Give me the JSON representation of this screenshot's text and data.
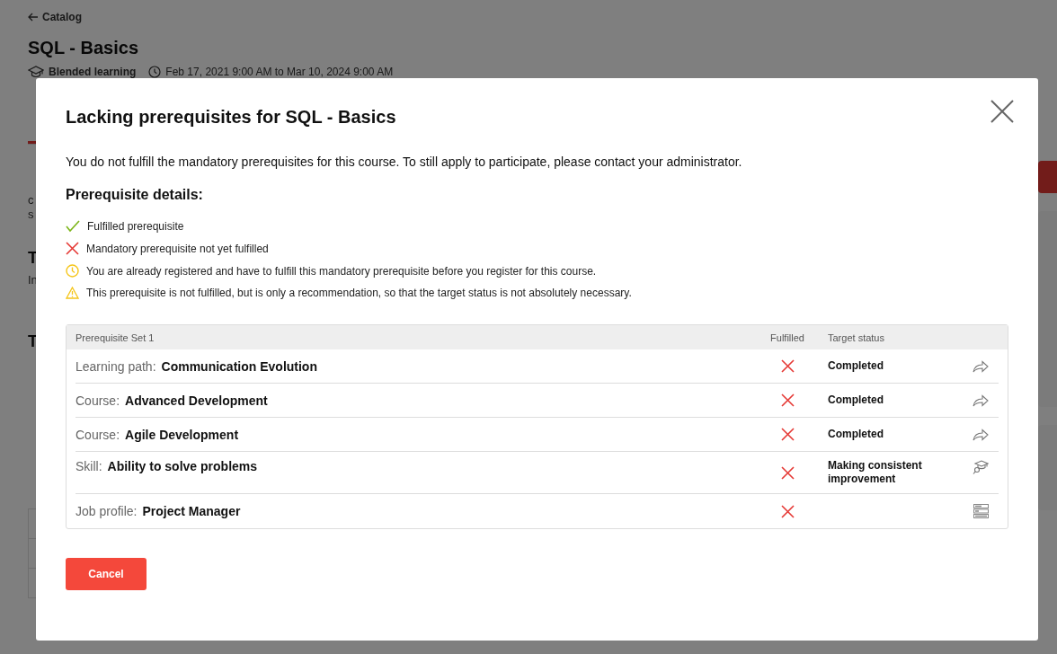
{
  "background": {
    "back_link": "Catalog",
    "title": "SQL - Basics",
    "type": "Blended learning",
    "dates": "Feb 17, 2021 9:00 AM to Mar 10, 2024 9:00 AM",
    "tabs": [
      {
        "selected": true
      }
    ],
    "sections": [
      {
        "lines": [
          "c",
          "s"
        ]
      },
      {
        "heading": "T",
        "lines": [
          "In"
        ]
      },
      {
        "heading": "T"
      }
    ]
  },
  "dialog": {
    "title": "Lacking prerequisites for SQL - Basics",
    "message": "You do not fulfill the mandatory prerequisites for this course. To still apply to participate, please contact your administrator.",
    "details_heading": "Prerequisite details:",
    "legend": [
      {
        "kind": "fulfilled",
        "text": "Fulfilled prerequisite"
      },
      {
        "kind": "missing",
        "text": "Mandatory prerequisite not yet fulfilled"
      },
      {
        "kind": "pending",
        "text": "You are already registered and have to fulfill this mandatory prerequisite before you register for this course."
      },
      {
        "kind": "recommended",
        "text": "This prerequisite is not fulfilled, but is only a recommendation, so that the target status is not absolutely necessary."
      }
    ],
    "table": {
      "title": "Prerequisite Set 1",
      "columns": [
        "Fulfilled",
        "Target status"
      ],
      "rows": [
        {
          "kind": "learning-path",
          "type": "Learning path:",
          "name": "Communication Evolution",
          "fulfilled": false,
          "target": "Completed"
        },
        {
          "kind": "course",
          "type": "Course:",
          "name": "Advanced Development",
          "fulfilled": false,
          "target": "Completed"
        },
        {
          "kind": "course",
          "type": "Course:",
          "name": "Agile Development",
          "fulfilled": false,
          "target": "Completed"
        },
        {
          "kind": "skill",
          "type": "Skill:",
          "name": "Ability to solve problems",
          "fulfilled": false,
          "target": "Making consistent improvement"
        },
        {
          "kind": "job-profile",
          "type": "Job profile:",
          "name": "Project Manager",
          "fulfilled": false
        }
      ]
    },
    "cancel": "Cancel"
  }
}
